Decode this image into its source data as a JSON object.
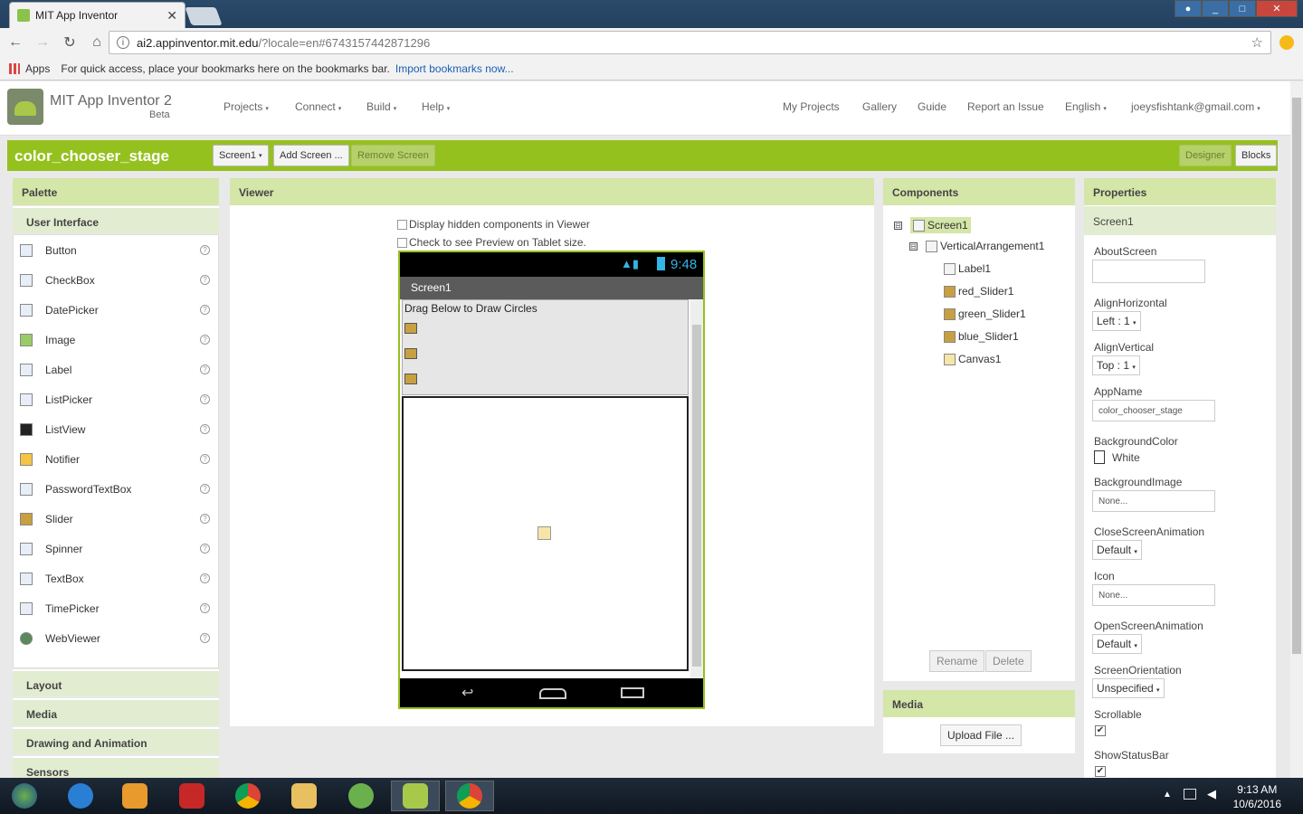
{
  "browser": {
    "tab_title": "MIT App Inventor",
    "tab_close": "✕",
    "url_host": "ai2.appinventor.mit.edu",
    "url_rest": "/?locale=en#6743157442871296",
    "bookmarks_apps": "Apps",
    "bookmarks_hint": "For quick access, place your bookmarks here on the bookmarks bar.",
    "bookmarks_import": "Import bookmarks now..."
  },
  "header": {
    "title": "MIT App Inventor 2",
    "beta": "Beta",
    "menus": [
      "Projects",
      "Connect",
      "Build",
      "Help"
    ],
    "right_links": [
      "My Projects",
      "Gallery",
      "Guide",
      "Report an Issue",
      "English",
      "joeysfishtank@gmail.com"
    ]
  },
  "project": {
    "name": "color_chooser_stage",
    "screen_select": "Screen1",
    "add_screen": "Add Screen ...",
    "remove_screen": "Remove Screen",
    "designer": "Designer",
    "blocks": "Blocks"
  },
  "palette": {
    "title": "Palette",
    "category_open": "User Interface",
    "items": [
      "Button",
      "CheckBox",
      "DatePicker",
      "Image",
      "Label",
      "ListPicker",
      "ListView",
      "Notifier",
      "PasswordTextBox",
      "Slider",
      "Spinner",
      "TextBox",
      "TimePicker",
      "WebViewer"
    ],
    "help": "?",
    "categories": [
      "Layout",
      "Media",
      "Drawing and Animation",
      "Sensors"
    ]
  },
  "viewer": {
    "title": "Viewer",
    "show_hidden": "Display hidden components in Viewer",
    "tablet_preview": "Check to see Preview on Tablet size.",
    "clock": "9:48",
    "screen_title": "Screen1",
    "label_text": "Drag Below to Draw Circles"
  },
  "components": {
    "title": "Components",
    "tree": [
      {
        "name": "Screen1",
        "level": 0
      },
      {
        "name": "VerticalArrangement1",
        "level": 1
      },
      {
        "name": "Label1",
        "level": 2
      },
      {
        "name": "red_Slider1",
        "level": 2
      },
      {
        "name": "green_Slider1",
        "level": 2
      },
      {
        "name": "blue_Slider1",
        "level": 2
      },
      {
        "name": "Canvas1",
        "level": 2
      }
    ],
    "collapse": "⊟",
    "rename": "Rename",
    "delete": "Delete"
  },
  "media": {
    "title": "Media",
    "upload": "Upload File ..."
  },
  "properties": {
    "title": "Properties",
    "component": "Screen1",
    "about_screen_label": "AboutScreen",
    "align_horizontal_label": "AlignHorizontal",
    "align_horizontal_value": "Left : 1",
    "align_vertical_label": "AlignVertical",
    "align_vertical_value": "Top : 1",
    "app_name_label": "AppName",
    "app_name_value": "color_chooser_stage",
    "background_color_label": "BackgroundColor",
    "background_color_value": "White",
    "background_image_label": "BackgroundImage",
    "background_image_value": "None...",
    "close_screen_animation_label": "CloseScreenAnimation",
    "close_screen_animation_value": "Default",
    "icon_label": "Icon",
    "icon_value": "None...",
    "open_screen_animation_label": "OpenScreenAnimation",
    "open_screen_animation_value": "Default",
    "screen_orientation_label": "ScreenOrientation",
    "screen_orientation_value": "Unspecified",
    "scrollable_label": "Scrollable",
    "scrollable_checked": true,
    "show_status_bar_label": "ShowStatusBar",
    "show_status_bar_checked": true
  },
  "taskbar": {
    "time": "9:13 AM",
    "date": "10/6/2016"
  },
  "colors": {
    "accent_green": "#95c11f",
    "panel_header": "#d4e6a8"
  },
  "icons": {
    "check": "✔",
    "caret": "▾"
  }
}
